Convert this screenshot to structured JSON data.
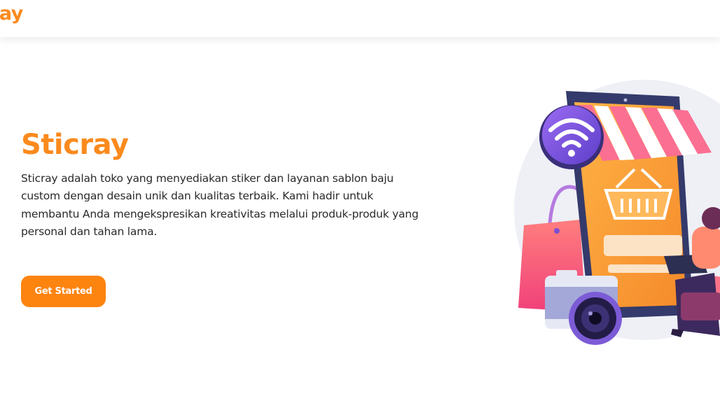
{
  "navbar": {
    "brand": "ray"
  },
  "hero": {
    "title": "Sticray",
    "description": "Sticray adalah toko yang menyediakan stiker dan layanan sablon baju custom dengan desain unik dan kualitas terbaik. Kami hadir untuk membantu Anda mengekspresikan kreativitas melalui produk-produk yang personal dan tahan lama.",
    "cta_label": "Get Started",
    "illustration": {
      "icons": [
        "wifi-icon",
        "shopping-basket-icon",
        "shopping-bag-icon",
        "camera-icon",
        "person-with-laptop"
      ]
    }
  },
  "colors": {
    "brand_orange": "#fb8a1d",
    "button_orange": "#fe8410",
    "awning_pink": "#fb6f92",
    "phone_frame": "#343a6b"
  }
}
